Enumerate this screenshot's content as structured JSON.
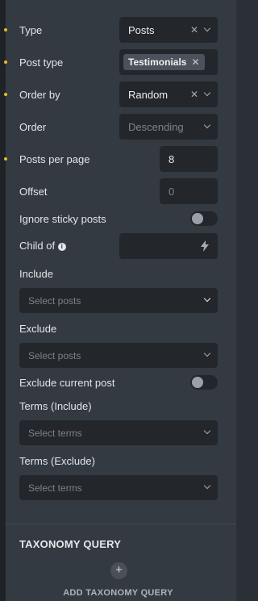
{
  "fields": {
    "type": {
      "label": "Type",
      "value": "Posts"
    },
    "post_type": {
      "label": "Post type",
      "tag": "Testimonials"
    },
    "order_by": {
      "label": "Order by",
      "value": "Random"
    },
    "order": {
      "label": "Order",
      "placeholder": "Descending"
    },
    "posts_per_page": {
      "label": "Posts per page",
      "value": "8"
    },
    "offset": {
      "label": "Offset",
      "placeholder": "0"
    },
    "ignore_sticky": {
      "label": "Ignore sticky posts"
    },
    "child_of": {
      "label": "Child of"
    },
    "include": {
      "label": "Include",
      "placeholder": "Select posts"
    },
    "exclude": {
      "label": "Exclude",
      "placeholder": "Select posts"
    },
    "exclude_current": {
      "label": "Exclude current post"
    },
    "terms_include": {
      "label": "Terms (Include)",
      "placeholder": "Select terms"
    },
    "terms_exclude": {
      "label": "Terms (Exclude)",
      "placeholder": "Select terms"
    }
  },
  "taxonomy": {
    "title": "TAXONOMY QUERY",
    "add_label": "ADD TAXONOMY QUERY"
  },
  "icons": {
    "clear": "close-icon",
    "chevron": "chevron-down-icon",
    "info": "info-icon",
    "dynamic": "bolt-icon",
    "add": "plus-icon"
  },
  "colors": {
    "accent_dot": "#f0b92a",
    "panel": "#343a41",
    "control": "#23272c"
  }
}
